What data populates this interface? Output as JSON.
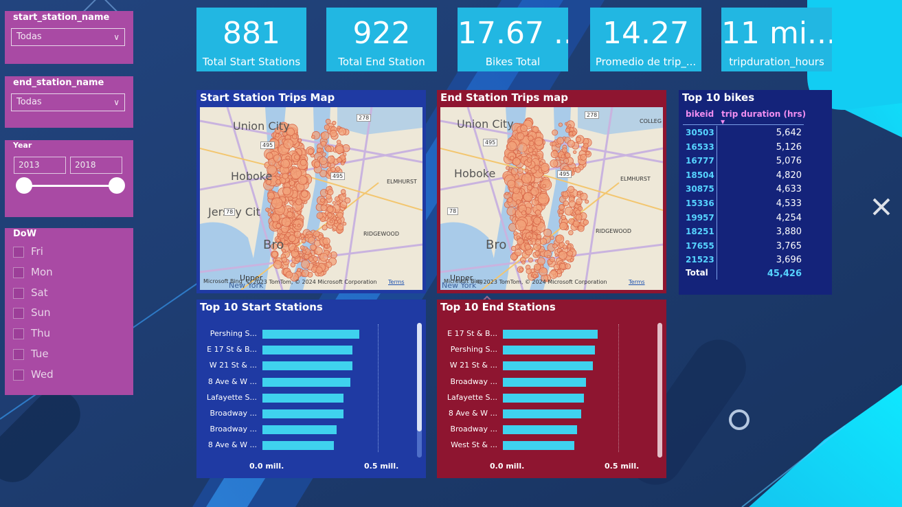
{
  "filters": {
    "start_station": {
      "label": "start_station_name",
      "value": "Todas"
    },
    "end_station": {
      "label": "end_station_name",
      "value": "Todas"
    },
    "year": {
      "label": "Year",
      "from": "2013",
      "to": "2018",
      "range": [
        2013,
        2018
      ]
    },
    "dow": {
      "label": "DoW",
      "options": [
        "Fri",
        "Mon",
        "Sat",
        "Sun",
        "Thu",
        "Tue",
        "Wed"
      ]
    }
  },
  "kpis": [
    {
      "value": "881",
      "label": "Total Start Stations"
    },
    {
      "value": "922",
      "label": "Total End Station"
    },
    {
      "value": "17.67 ...",
      "label": "Bikes Total"
    },
    {
      "value": "14.27",
      "label": "Promedio de trip_..."
    },
    {
      "value": "11 mi...",
      "label": "tripduration_hours"
    }
  ],
  "maps": {
    "start": {
      "title": "Start Station Trips Map",
      "places": [
        "Union City",
        "Hoboke",
        "Jersey Cit",
        "Bro",
        "ELMHURST",
        "RIDGEWOOD",
        "Upper",
        "New York"
      ],
      "shields": [
        "495",
        "278",
        "495",
        "78"
      ],
      "copyright": "© 2023 TomTom, © 2024 Microsoft Corporation",
      "terms": "Terms",
      "brand": "Microsoft Bing"
    },
    "end": {
      "title": "End Station Trips map",
      "places": [
        "Union City",
        "Hoboke",
        "Bro",
        "ELMHURST",
        "RIDGEWOOD",
        "COLLEG",
        "Upper",
        "New York"
      ],
      "shields": [
        "495",
        "278",
        "495",
        "78"
      ],
      "copyright": "© 2023 TomTom, © 2024 Microsoft Corporation",
      "terms": "Terms",
      "brand": "Microsoft Bing"
    }
  },
  "top_bikes": {
    "title": "Top 10 bikes",
    "col1": "bikeid",
    "col2": "trip duration (hrs)",
    "rows": [
      {
        "id": "30503",
        "value": "5,642"
      },
      {
        "id": "16533",
        "value": "5,126"
      },
      {
        "id": "16777",
        "value": "5,076"
      },
      {
        "id": "18504",
        "value": "4,820"
      },
      {
        "id": "30875",
        "value": "4,633"
      },
      {
        "id": "15336",
        "value": "4,533"
      },
      {
        "id": "19957",
        "value": "4,254"
      },
      {
        "id": "18251",
        "value": "3,880"
      },
      {
        "id": "17655",
        "value": "3,765"
      },
      {
        "id": "21523",
        "value": "3,696"
      }
    ],
    "total_label": "Total",
    "total_value": "45,426"
  },
  "colors": {
    "kpi": "#22b7e2",
    "slicer": "#a94aa4",
    "start_panel": "#1f3aa3",
    "end_panel": "#8e1530",
    "bar": "#3fd2ee",
    "station_dot": "#f2a27a"
  },
  "chart_data": [
    {
      "type": "bar",
      "title": "Top 10 Start Stations",
      "categories": [
        "Pershing S...",
        "E 17 St & B...",
        "W 21 St & ...",
        "8 Ave & W ...",
        "Lafayette S...",
        "Broadway ...",
        "Broadway ...",
        "8 Ave & W ..."
      ],
      "values": [
        0.42,
        0.39,
        0.39,
        0.38,
        0.35,
        0.35,
        0.32,
        0.31
      ],
      "ticks": [
        "0.0 mill.",
        "0.5 mill."
      ],
      "xlim": [
        0,
        0.5
      ],
      "orientation": "horizontal"
    },
    {
      "type": "bar",
      "title": "Top 10 End Stations",
      "categories": [
        "E 17 St & B...",
        "Pershing S...",
        "W 21 St & ...",
        "Broadway ...",
        "Lafayette S...",
        "8 Ave & W ...",
        "Broadway ...",
        "West St & ..."
      ],
      "values": [
        0.41,
        0.4,
        0.39,
        0.36,
        0.35,
        0.34,
        0.32,
        0.31
      ],
      "ticks": [
        "0.0 mill.",
        "0.5 mill."
      ],
      "xlim": [
        0,
        0.5
      ],
      "orientation": "horizontal"
    }
  ]
}
